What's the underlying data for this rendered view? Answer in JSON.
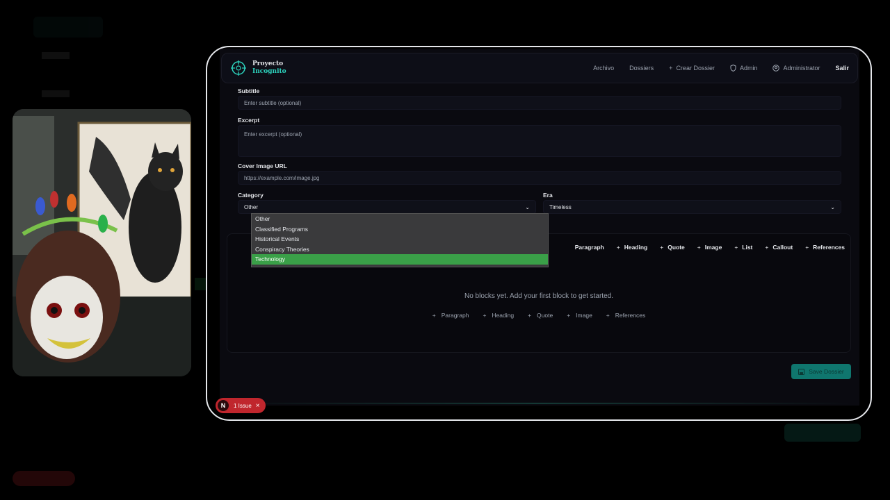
{
  "nav": {
    "brand_line1": "Proyecto",
    "brand_line2": "Incognito",
    "links": [
      "Archivo",
      "Dossiers",
      "Crear Dossier",
      "Admin",
      "Administrator",
      "Salir"
    ]
  },
  "form": {
    "subtitle_label": "Subtitle",
    "subtitle_placeholder": "Enter subtitle (optional)",
    "excerpt_label": "Excerpt",
    "excerpt_placeholder": "Enter excerpt (optional)",
    "cover_label": "Cover Image URL",
    "cover_placeholder": "https://example.com/image.jpg",
    "category_label": "Category",
    "category_value": "Other",
    "era_label": "Era",
    "era_value": "Timeless"
  },
  "dropdown": {
    "options": [
      "Other",
      "Classified Programs",
      "Historical Events",
      "Conspiracy Theories",
      "Technology"
    ],
    "highlighted": "Technology"
  },
  "blocks": {
    "toolbar": [
      "Paragraph",
      "Heading",
      "Quote",
      "Image",
      "List",
      "Callout",
      "References"
    ],
    "empty_text": "No blocks yet. Add your first block to get started.",
    "quick_add": [
      "Paragraph",
      "Heading",
      "Quote",
      "Image",
      "References"
    ]
  },
  "save_label": "Save Dossier",
  "issue": {
    "badge": "N",
    "label": "1 Issue"
  },
  "colors": {
    "accent": "#2dd4bf",
    "highlight": "#3aa048",
    "danger": "#c0262d",
    "save": "#0f766e"
  }
}
